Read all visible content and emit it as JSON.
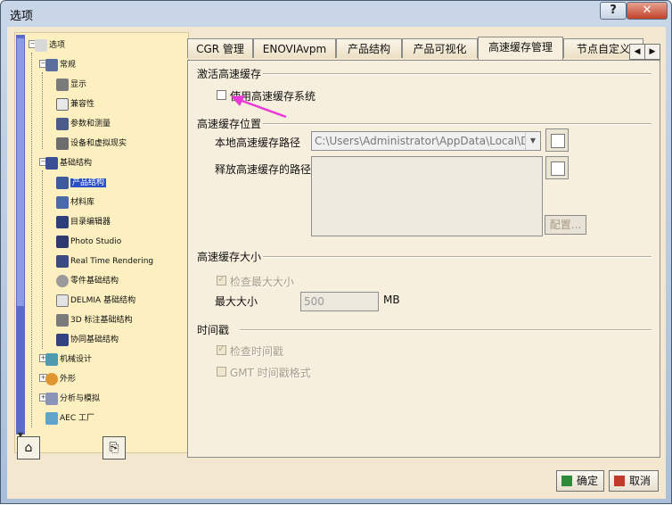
{
  "window": {
    "title": "选项"
  },
  "title_buttons": {
    "help": "?",
    "close": "✕"
  },
  "tree": {
    "items": [
      {
        "label": "选项",
        "icon": "options-icon"
      },
      {
        "label": "常规",
        "icon": "general-icon"
      },
      {
        "label": "显示",
        "icon": "display-icon"
      },
      {
        "label": "兼容性",
        "icon": "compatibility-icon"
      },
      {
        "label": "参数和测量",
        "icon": "parameters-icon"
      },
      {
        "label": "设备和虚拟现实",
        "icon": "devices-icon"
      },
      {
        "label": "基础结构",
        "icon": "infrastructure-icon"
      },
      {
        "label": "产品结构",
        "icon": "product-structure-icon"
      },
      {
        "label": "材料库",
        "icon": "material-library-icon"
      },
      {
        "label": "目录编辑器",
        "icon": "catalog-editor-icon"
      },
      {
        "label": "Photo Studio",
        "icon": "photo-studio-icon"
      },
      {
        "label": "Real Time Rendering",
        "icon": "rendering-icon"
      },
      {
        "label": "零件基础结构",
        "icon": "part-infrastructure-icon"
      },
      {
        "label": "DELMIA 基础结构",
        "icon": "delmia-icon"
      },
      {
        "label": "3D 标注基础结构",
        "icon": "annotation-icon"
      },
      {
        "label": "协同基础结构",
        "icon": "collaboration-icon"
      },
      {
        "label": "机械设计",
        "icon": "mechanical-design-icon"
      },
      {
        "label": "外形",
        "icon": "shape-icon"
      },
      {
        "label": "分析与模拟",
        "icon": "analysis-icon"
      },
      {
        "label": "AEC 工厂",
        "icon": "aec-icon"
      }
    ]
  },
  "tabs": [
    {
      "label": "CGR 管理"
    },
    {
      "label": "ENOVIAvpm"
    },
    {
      "label": "产品结构"
    },
    {
      "label": "产品可视化"
    },
    {
      "label": "高速缓存管理"
    },
    {
      "label": "节点自定义"
    }
  ],
  "panel": {
    "activate_group": "激活高速缓存",
    "use_cache_label": "使用高速缓存系统",
    "location_group": "高速缓存位置",
    "local_path_label": "本地高速缓存路径",
    "local_path_value": "C:\\Users\\Administrator\\AppData\\Local\\D",
    "release_path_label": "释放高速缓存的路径",
    "configure_button": "配置...",
    "size_group": "高速缓存大小",
    "check_max_label": "检查最大大小",
    "max_size_label": "最大大小",
    "max_size_value": "500",
    "max_size_unit": "MB",
    "timestamp_group": "时间戳",
    "check_timestamp_label": "检查时间戳",
    "gmt_label": "GMT 时间戳格式"
  },
  "footer": {
    "ok": "确定",
    "cancel": "取消"
  }
}
